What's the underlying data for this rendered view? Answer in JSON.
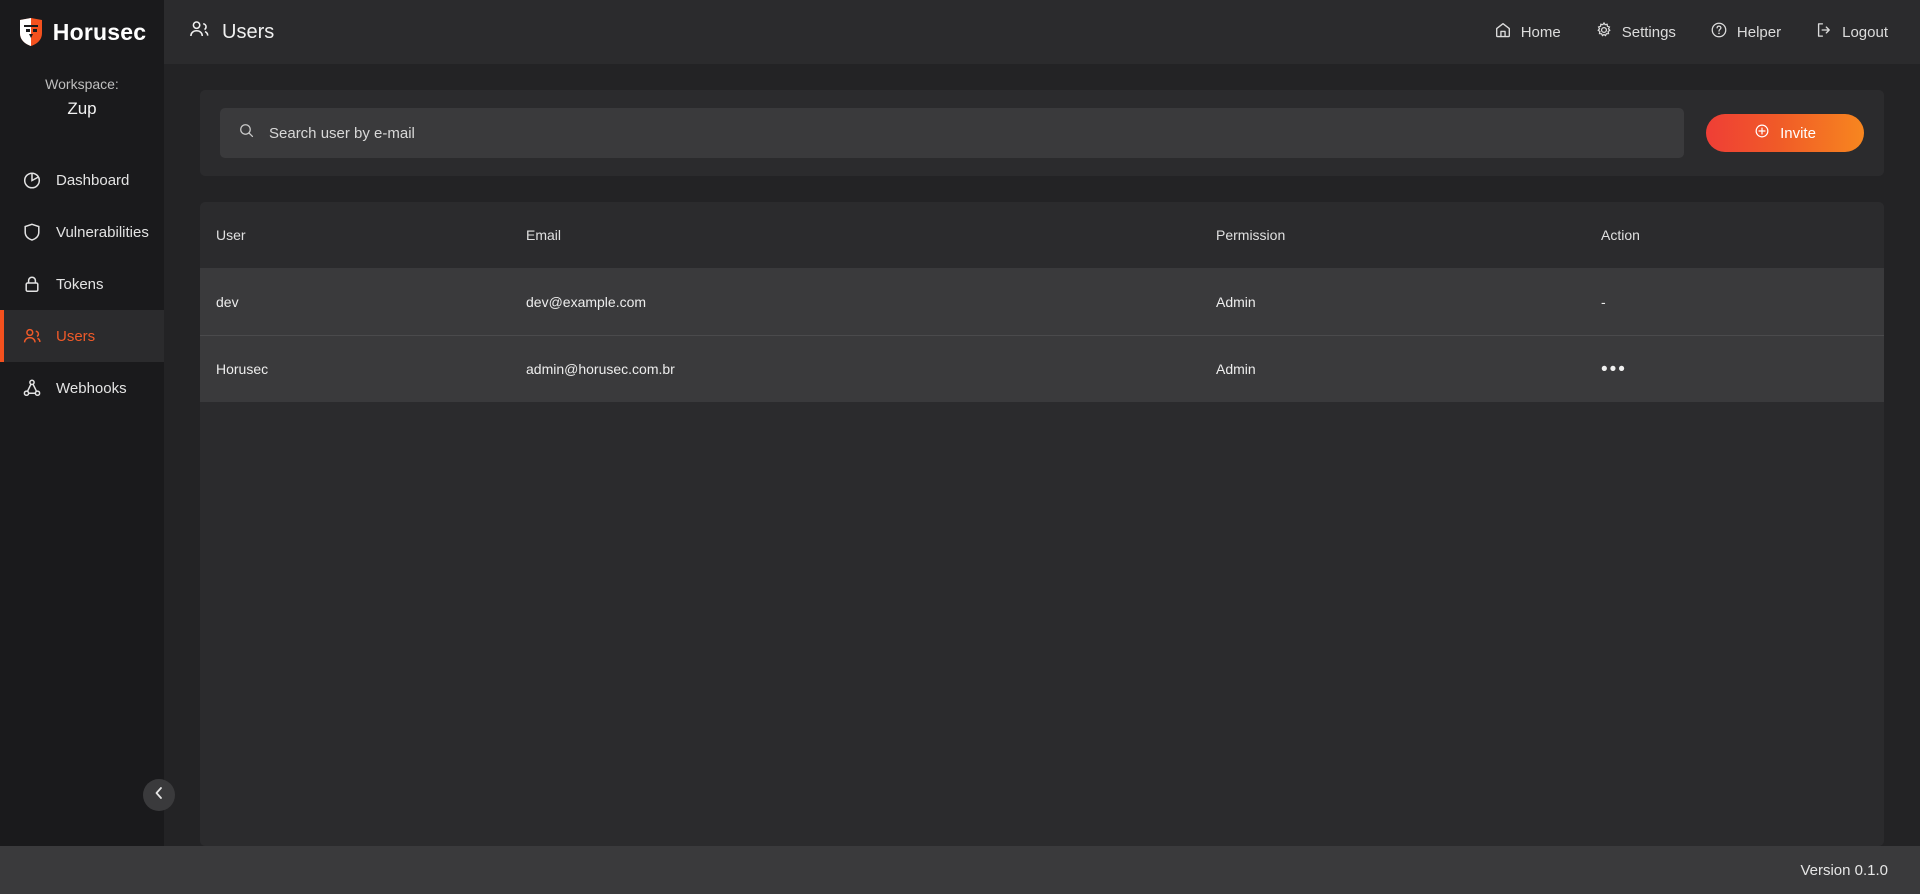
{
  "brand": {
    "name": "Horusec",
    "logo_icon": "shield-logo-icon"
  },
  "sidebar": {
    "workspace_label": "Workspace:",
    "workspace_name": "Zup",
    "collapse_icon": "chevron-left-icon",
    "items": [
      {
        "label": "Dashboard",
        "icon": "pie-chart-icon",
        "active": false
      },
      {
        "label": "Vulnerabilities",
        "icon": "shield-icon",
        "active": false
      },
      {
        "label": "Tokens",
        "icon": "lock-icon",
        "active": false
      },
      {
        "label": "Users",
        "icon": "users-icon",
        "active": true
      },
      {
        "label": "Webhooks",
        "icon": "webhook-icon",
        "active": false
      }
    ]
  },
  "topbar": {
    "title": "Users",
    "title_icon": "users-icon",
    "menu": [
      {
        "label": "Home",
        "icon": "home-icon"
      },
      {
        "label": "Settings",
        "icon": "gear-icon"
      },
      {
        "label": "Helper",
        "icon": "question-circle-icon"
      },
      {
        "label": "Logout",
        "icon": "logout-icon"
      }
    ]
  },
  "search": {
    "placeholder": "Search user by e-mail",
    "value": "",
    "icon": "search-icon"
  },
  "invite_button": {
    "label": "Invite",
    "icon": "plus-circle-icon"
  },
  "table": {
    "columns": [
      "User",
      "Email",
      "Permission",
      "Action"
    ],
    "rows": [
      {
        "user": "dev",
        "email": "dev@example.com",
        "permission": "Admin",
        "action": "-",
        "action_type": "dash"
      },
      {
        "user": "Horusec",
        "email": "admin@horusec.com.br",
        "permission": "Admin",
        "action": "•••",
        "action_type": "menu"
      }
    ]
  },
  "footer": {
    "version": "Version 0.1.0"
  },
  "colors": {
    "accent": "#ef5a29",
    "gradient_start": "#ef3e36",
    "gradient_end": "#f7861f",
    "sidebar_bg": "#1a1a1c",
    "page_bg": "#232325",
    "card_bg": "#2b2b2d",
    "row_bg": "#3a3a3c"
  }
}
